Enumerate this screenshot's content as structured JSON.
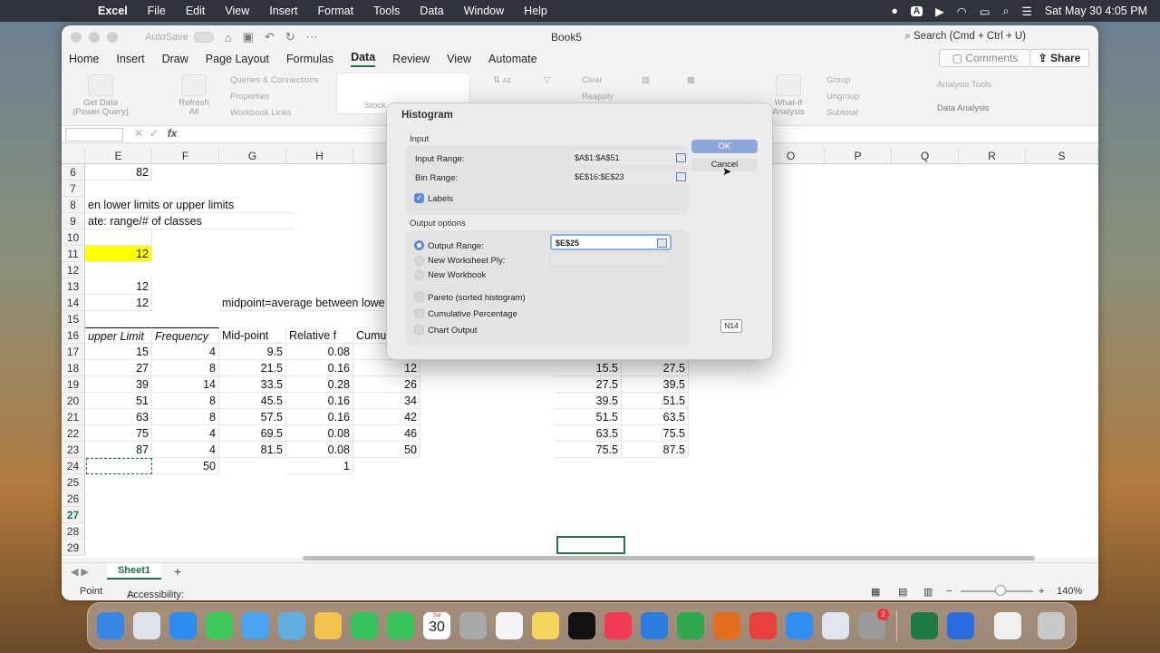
{
  "menubar": {
    "app": "Excel",
    "items": [
      "File",
      "Edit",
      "View",
      "Insert",
      "Format",
      "Tools",
      "Data",
      "Window",
      "Help"
    ],
    "datetime": "Sat May 30  4:05 PM",
    "input_indicator": "A"
  },
  "window": {
    "title": "Book5",
    "autosave": "AutoSave",
    "search": "Search (Cmd + Ctrl + U)",
    "comments": "Comments",
    "share": "Share"
  },
  "ribbon_tabs": [
    "Home",
    "Insert",
    "Draw",
    "Page Layout",
    "Formulas",
    "Data",
    "Review",
    "View",
    "Automate"
  ],
  "ribbon": {
    "get_data": "Get Data (Power Query)",
    "refresh_all": "Refresh All",
    "queries": "Queries & Connections",
    "properties": "Properties",
    "workbook_links": "Workbook Links",
    "stocks": "Stock",
    "clear": "Clear",
    "reapply": "Reapply",
    "what_if": "What-If Analysis",
    "group": "Group",
    "ungroup": "Ungroup",
    "subtotal": "Subtotal",
    "analysis_tools": "Analysis Tools",
    "data_analysis": "Data Analysis"
  },
  "formula_bar": {
    "name_box": "",
    "fx": "fx"
  },
  "columns": [
    "E",
    "F",
    "G",
    "H",
    "O",
    "P",
    "Q",
    "R",
    "S"
  ],
  "rows": [
    "6",
    "7",
    "8",
    "9",
    "10",
    "11",
    "12",
    "13",
    "14",
    "15",
    "16",
    "17",
    "18",
    "19",
    "20",
    "21",
    "22",
    "23",
    "24",
    "25",
    "26",
    "27",
    "28",
    "29"
  ],
  "cells": {
    "e6": "82",
    "e8": "en lower limits or upper limits",
    "e9": "ate: range/# of classes",
    "e11": "12",
    "e13": "12",
    "e14": "12",
    "g14": "midpoint=average between lowe",
    "e16": "upper Limit",
    "f16": "Frequency",
    "g16": "Mid-point",
    "h16": "Relative f",
    "i16": "Cumu",
    "e24": "",
    "f24": "50",
    "h24": "1",
    "table": [
      [
        "15",
        "4",
        "9.5",
        "0.08",
        "",
        "",
        ""
      ],
      [
        "27",
        "8",
        "21.5",
        "0.16",
        "12",
        "15.5",
        "27.5"
      ],
      [
        "39",
        "14",
        "33.5",
        "0.28",
        "26",
        "27.5",
        "39.5"
      ],
      [
        "51",
        "8",
        "45.5",
        "0.16",
        "34",
        "39.5",
        "51.5"
      ],
      [
        "63",
        "8",
        "57.5",
        "0.16",
        "42",
        "51.5",
        "63.5"
      ],
      [
        "75",
        "4",
        "69.5",
        "0.08",
        "46",
        "63.5",
        "75.5"
      ],
      [
        "87",
        "4",
        "81.5",
        "0.08",
        "50",
        "75.5",
        "87.5"
      ]
    ]
  },
  "sheet_tab": "Sheet1",
  "status": {
    "mode": "Point",
    "accessibility": "Accessibility: Good to go",
    "zoom": "140%"
  },
  "dialog": {
    "title": "Histogram",
    "input_section": "Input",
    "input_range_label": "Input Range:",
    "input_range": "$A$1:$A$51",
    "bin_range_label": "Bin Range:",
    "bin_range": "$E$16:$E$23",
    "labels": "Labels",
    "output_section": "Output options",
    "output_range_label": "Output Range:",
    "output_range": "$E$25",
    "new_ply": "New Worksheet Ply:",
    "new_workbook": "New Workbook",
    "pareto": "Pareto (sorted histogram)",
    "cumulative": "Cumulative Percentage",
    "chart_output": "Chart Output",
    "ok": "OK",
    "cancel": "Cancel",
    "tooltip": "N14"
  },
  "dock": {
    "calendar_month": "Sat",
    "calendar_day": "30",
    "badge": "2"
  }
}
